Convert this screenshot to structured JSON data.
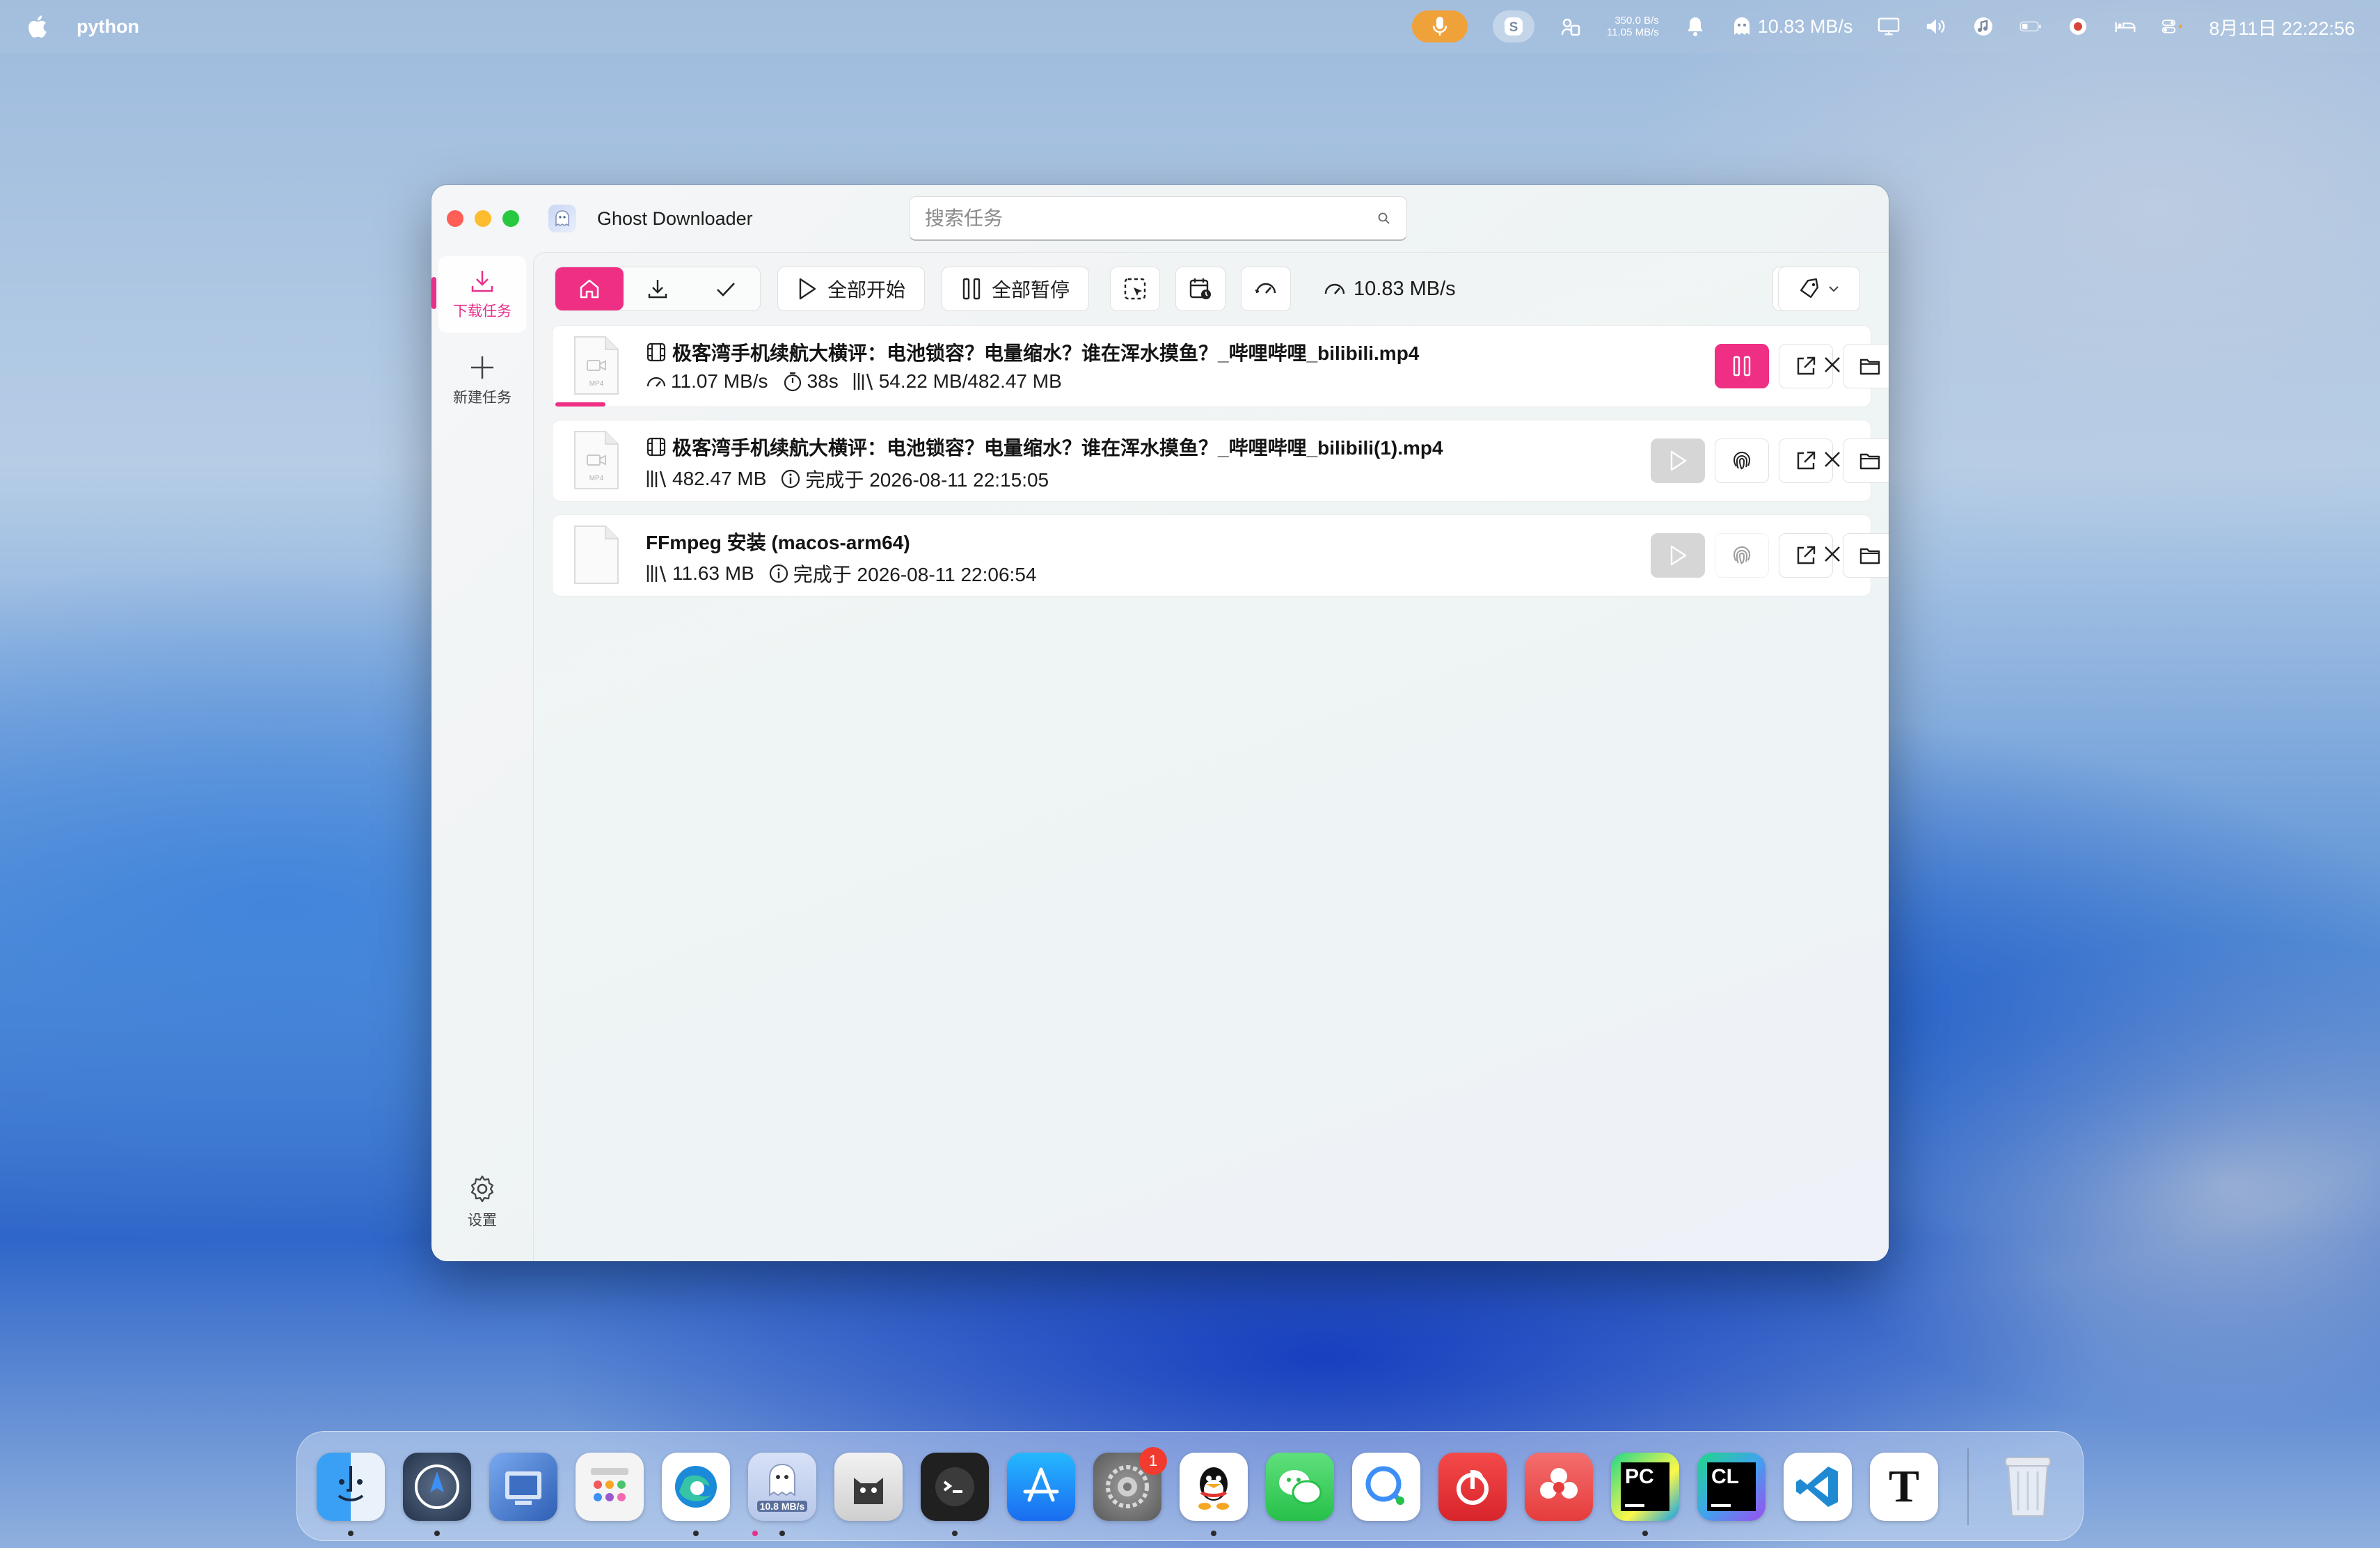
{
  "menubar": {
    "app_name": "python",
    "net_up": "350.0 B/s",
    "net_down": "11.05 MB/s",
    "speed": "10.83 MB/s",
    "datetime": "8月11日  22:22:56"
  },
  "window": {
    "title": "Ghost Downloader",
    "search_placeholder": "搜索任务"
  },
  "sidebar": {
    "items": [
      {
        "label": "下载任务",
        "icon": "download-icon",
        "active": true
      },
      {
        "label": "新建任务",
        "icon": "plus-icon"
      },
      {
        "label": "设置",
        "icon": "gear-icon"
      }
    ]
  },
  "toolbar": {
    "start_all": "全部开始",
    "pause_all": "全部暂停",
    "speed": "10.83 MB/s"
  },
  "tasks": [
    {
      "name": "极客湾手机续航大横评：电池锁容？电量缩水？谁在浑水摸鱼？_哔哩哔哩_bilibili.mp4",
      "file_type": "MP4",
      "speed": "11.07 MB/s",
      "eta": "38s",
      "progress_text": "54.22 MB/482.47 MB",
      "progress": 0.112,
      "status": "downloading"
    },
    {
      "name": "极客湾手机续航大横评：电池锁容？电量缩水？谁在浑水摸鱼？_哔哩哔哩_bilibili(1).mp4",
      "file_type": "MP4",
      "size": "482.47 MB",
      "completed": "完成于 2026-08-11 22:15:05",
      "status": "completed"
    },
    {
      "name": "FFmpeg 安装 (macos-arm64)",
      "size": "11.63 MB",
      "completed": "完成于 2026-08-11 22:06:54",
      "status": "completed"
    }
  ],
  "dock": {
    "ghost_badge": "10.8 MB/s",
    "settings_badge": "1",
    "pycharm_label": "PC",
    "clion_label": "CL",
    "typora_label": "T"
  },
  "colors": {
    "accent": "#ee2f84",
    "disabled": "#d6d6d6"
  }
}
